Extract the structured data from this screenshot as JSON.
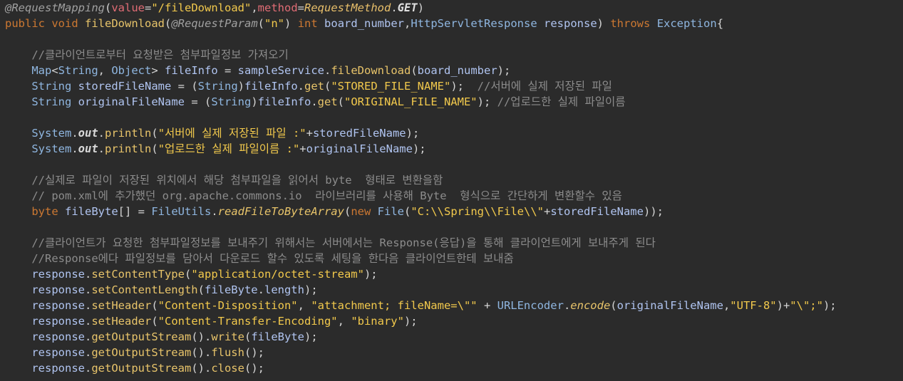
{
  "editor": {
    "language": "java",
    "colors": {
      "background": "#2b2b2b",
      "keyword": "#cc7832",
      "string": "#f2c94c",
      "comment": "#8c8c8c",
      "type": "#8fb6e0"
    },
    "lines": [
      [
        [
          "ann",
          "@RequestMapping"
        ],
        [
          "txt",
          "("
        ],
        [
          "attr",
          "value"
        ],
        [
          "txt",
          "="
        ],
        [
          "str",
          "\"/fileDownload\""
        ],
        [
          "txt",
          ","
        ],
        [
          "attr",
          "method"
        ],
        [
          "txt",
          "="
        ],
        [
          "cls",
          "RequestMethod"
        ],
        [
          "txt",
          "."
        ],
        [
          "field",
          "GET"
        ],
        [
          "txt",
          ")"
        ]
      ],
      [
        [
          "kw",
          "public"
        ],
        [
          "txt",
          " "
        ],
        [
          "kw",
          "void"
        ],
        [
          "txt",
          " "
        ],
        [
          "fn",
          "fileDownload"
        ],
        [
          "txt",
          "("
        ],
        [
          "ann",
          "@RequestParam"
        ],
        [
          "txt",
          "("
        ],
        [
          "str",
          "\"n\""
        ],
        [
          "txt",
          ") "
        ],
        [
          "kw",
          "int"
        ],
        [
          "txt",
          " "
        ],
        [
          "var",
          "board_number"
        ],
        [
          "txt",
          ","
        ],
        [
          "type",
          "HttpServletResponse"
        ],
        [
          "txt",
          " "
        ],
        [
          "var",
          "response"
        ],
        [
          "txt",
          ") "
        ],
        [
          "kw",
          "throws"
        ],
        [
          "txt",
          " "
        ],
        [
          "type",
          "Exception"
        ],
        [
          "txt",
          "{"
        ]
      ],
      [],
      [
        [
          "txt",
          "    "
        ],
        [
          "com",
          "//클라이언트로부터 요청받은 첨부파일정보 가져오기"
        ]
      ],
      [
        [
          "txt",
          "    "
        ],
        [
          "type",
          "Map"
        ],
        [
          "txt",
          "<"
        ],
        [
          "type",
          "String"
        ],
        [
          "txt",
          ", "
        ],
        [
          "type",
          "Object"
        ],
        [
          "txt",
          "> "
        ],
        [
          "var",
          "fileInfo"
        ],
        [
          "txt",
          " = "
        ],
        [
          "var",
          "sampleService"
        ],
        [
          "txt",
          "."
        ],
        [
          "fn",
          "fileDownload"
        ],
        [
          "txt",
          "("
        ],
        [
          "var",
          "board_number"
        ],
        [
          "txt",
          ");"
        ]
      ],
      [
        [
          "txt",
          "    "
        ],
        [
          "type",
          "String"
        ],
        [
          "txt",
          " "
        ],
        [
          "var",
          "storedFileName"
        ],
        [
          "txt",
          " = ("
        ],
        [
          "type",
          "String"
        ],
        [
          "txt",
          ")"
        ],
        [
          "var",
          "fileInfo"
        ],
        [
          "txt",
          "."
        ],
        [
          "fn",
          "get"
        ],
        [
          "txt",
          "("
        ],
        [
          "str",
          "\"STORED_FILE_NAME\""
        ],
        [
          "txt",
          ");  "
        ],
        [
          "com",
          "//서버에 실제 저장된 파일"
        ]
      ],
      [
        [
          "txt",
          "    "
        ],
        [
          "type",
          "String"
        ],
        [
          "txt",
          " "
        ],
        [
          "var",
          "originalFileName"
        ],
        [
          "txt",
          " = ("
        ],
        [
          "type",
          "String"
        ],
        [
          "txt",
          ")"
        ],
        [
          "var",
          "fileInfo"
        ],
        [
          "txt",
          "."
        ],
        [
          "fn",
          "get"
        ],
        [
          "txt",
          "("
        ],
        [
          "str",
          "\"ORIGINAL_FILE_NAME\""
        ],
        [
          "txt",
          "); "
        ],
        [
          "com",
          "//업로드한 실제 파일이름"
        ]
      ],
      [],
      [
        [
          "txt",
          "    "
        ],
        [
          "type",
          "System"
        ],
        [
          "txt",
          "."
        ],
        [
          "static",
          "out"
        ],
        [
          "txt",
          "."
        ],
        [
          "fn",
          "println"
        ],
        [
          "txt",
          "("
        ],
        [
          "str",
          "\"서버에 실제 저장된 파일 :\""
        ],
        [
          "txt",
          "+"
        ],
        [
          "var",
          "storedFileName"
        ],
        [
          "txt",
          ");"
        ]
      ],
      [
        [
          "txt",
          "    "
        ],
        [
          "type",
          "System"
        ],
        [
          "txt",
          "."
        ],
        [
          "static",
          "out"
        ],
        [
          "txt",
          "."
        ],
        [
          "fn",
          "println"
        ],
        [
          "txt",
          "("
        ],
        [
          "str",
          "\"업로드한 실제 파일이름 :\""
        ],
        [
          "txt",
          "+"
        ],
        [
          "var",
          "originalFileName"
        ],
        [
          "txt",
          ");"
        ]
      ],
      [],
      [
        [
          "txt",
          "    "
        ],
        [
          "com",
          "//실제로 파일이 저장된 위치에서 해당 첨부파일을 읽어서 byte  형태로 변환을함"
        ]
      ],
      [
        [
          "txt",
          "    "
        ],
        [
          "com",
          "// pom.xml에 추가했던 org.apache.commons.io  라이브러리를 사용해 Byte  형식으로 간단하게 변환할수 있음"
        ]
      ],
      [
        [
          "txt",
          "    "
        ],
        [
          "kw",
          "byte"
        ],
        [
          "txt",
          " "
        ],
        [
          "var",
          "fileByte"
        ],
        [
          "txt",
          "[] = "
        ],
        [
          "type",
          "FileUtils"
        ],
        [
          "txt",
          "."
        ],
        [
          "smeth",
          "readFileToByteArray"
        ],
        [
          "txt",
          "("
        ],
        [
          "kw",
          "new"
        ],
        [
          "txt",
          " "
        ],
        [
          "type",
          "File"
        ],
        [
          "txt",
          "("
        ],
        [
          "str",
          "\"C:\\\\Spring\\\\File\\\\\""
        ],
        [
          "txt",
          "+"
        ],
        [
          "var",
          "storedFileName"
        ],
        [
          "txt",
          "));"
        ]
      ],
      [],
      [
        [
          "txt",
          "    "
        ],
        [
          "com",
          "//클라이언트가 요청한 첨부파일정보를 보내주기 위해서는 서버에서는 Response(응답)을 통해 클라이언트에게 보내주게 된다"
        ]
      ],
      [
        [
          "txt",
          "    "
        ],
        [
          "com",
          "//Response에다 파일정보를 담아서 다운로드 할수 있도록 세팅을 한다음 클라이언트한테 보내줌"
        ]
      ],
      [
        [
          "txt",
          "    "
        ],
        [
          "var",
          "response"
        ],
        [
          "txt",
          "."
        ],
        [
          "fn",
          "setContentType"
        ],
        [
          "txt",
          "("
        ],
        [
          "str",
          "\"application/octet-stream\""
        ],
        [
          "txt",
          ");"
        ]
      ],
      [
        [
          "txt",
          "    "
        ],
        [
          "var",
          "response"
        ],
        [
          "txt",
          "."
        ],
        [
          "fn",
          "setContentLength"
        ],
        [
          "txt",
          "("
        ],
        [
          "var",
          "fileByte"
        ],
        [
          "txt",
          "."
        ],
        [
          "var",
          "length"
        ],
        [
          "txt",
          ");"
        ]
      ],
      [
        [
          "txt",
          "    "
        ],
        [
          "var",
          "response"
        ],
        [
          "txt",
          "."
        ],
        [
          "fn",
          "setHeader"
        ],
        [
          "txt",
          "("
        ],
        [
          "str",
          "\"Content-Disposition\""
        ],
        [
          "txt",
          ", "
        ],
        [
          "str",
          "\"attachment; fileName=\\\"\""
        ],
        [
          "txt",
          " + "
        ],
        [
          "type",
          "URLEncoder"
        ],
        [
          "txt",
          "."
        ],
        [
          "smeth",
          "encode"
        ],
        [
          "txt",
          "("
        ],
        [
          "var",
          "originalFileName"
        ],
        [
          "txt",
          ","
        ],
        [
          "str",
          "\"UTF-8\""
        ],
        [
          "txt",
          ")+"
        ],
        [
          "str",
          "\"\\\";\""
        ],
        [
          "txt",
          ");"
        ]
      ],
      [
        [
          "txt",
          "    "
        ],
        [
          "var",
          "response"
        ],
        [
          "txt",
          "."
        ],
        [
          "fn",
          "setHeader"
        ],
        [
          "txt",
          "("
        ],
        [
          "str",
          "\"Content-Transfer-Encoding\""
        ],
        [
          "txt",
          ", "
        ],
        [
          "str",
          "\"binary\""
        ],
        [
          "txt",
          ");"
        ]
      ],
      [
        [
          "txt",
          "    "
        ],
        [
          "var",
          "response"
        ],
        [
          "txt",
          "."
        ],
        [
          "fn",
          "getOutputStream"
        ],
        [
          "txt",
          "()."
        ],
        [
          "fn",
          "write"
        ],
        [
          "txt",
          "("
        ],
        [
          "var",
          "fileByte"
        ],
        [
          "txt",
          ");"
        ]
      ],
      [
        [
          "txt",
          "    "
        ],
        [
          "var",
          "response"
        ],
        [
          "txt",
          "."
        ],
        [
          "fn",
          "getOutputStream"
        ],
        [
          "txt",
          "()."
        ],
        [
          "fn",
          "flush"
        ],
        [
          "txt",
          "();"
        ]
      ],
      [
        [
          "txt",
          "    "
        ],
        [
          "var",
          "response"
        ],
        [
          "txt",
          "."
        ],
        [
          "fn",
          "getOutputStream"
        ],
        [
          "txt",
          "()."
        ],
        [
          "fn",
          "close"
        ],
        [
          "txt",
          "();"
        ]
      ]
    ]
  }
}
